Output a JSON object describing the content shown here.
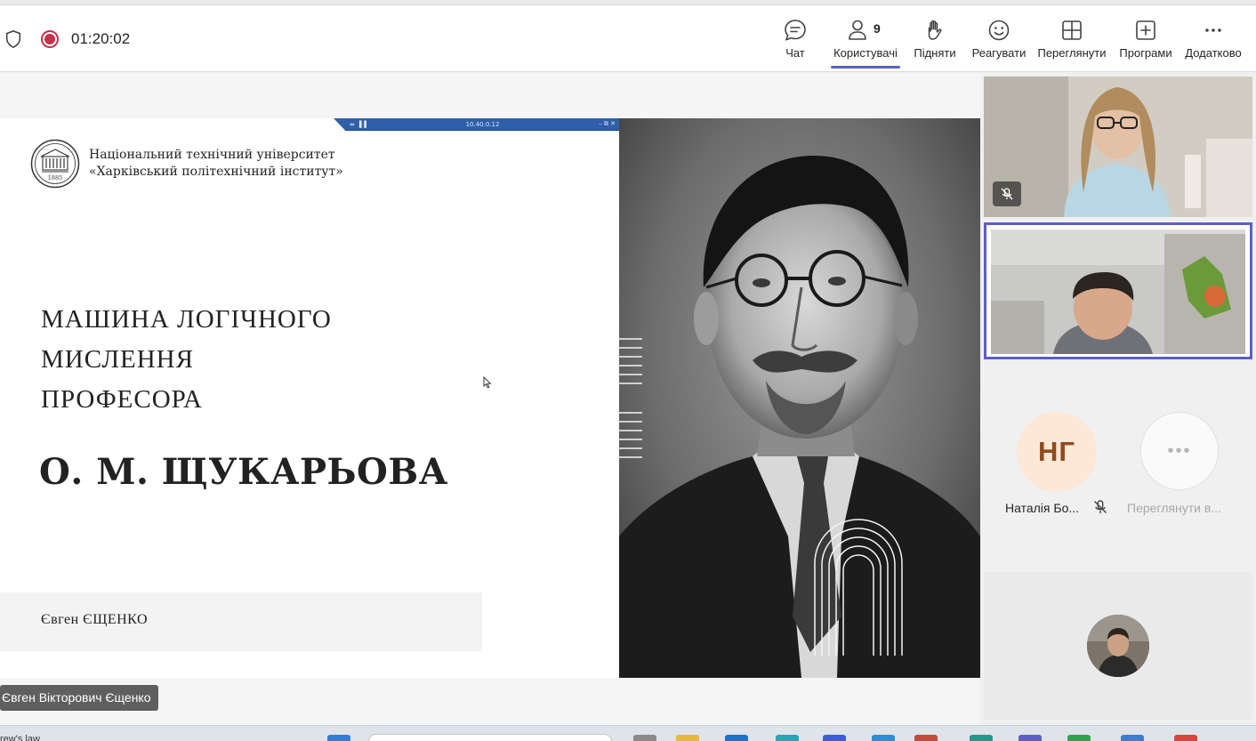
{
  "toolbar": {
    "timer": "01:20:02",
    "buttons": {
      "chat": "Чат",
      "people": "Користувачі",
      "people_count": "9",
      "raise": "Підняти",
      "react": "Реагувати",
      "view": "Переглянути",
      "apps": "Програми",
      "more": "Додатково"
    },
    "active_tab": "Користувачі",
    "accent_color": "#5b5fc7",
    "recording_color": "#c4314b"
  },
  "slide": {
    "remote_bar_ip": "10.40.0.12",
    "university_line1": "Національний технічний університет",
    "university_line2": "«Харківський політехнічний інститут»",
    "logo_year": "1885",
    "title_line1": "МАШИНА ЛОГІЧНОГО",
    "title_line2": "МИСЛЕННЯ",
    "title_line3": "ПРОФЕСОРА",
    "title_name": "О. М. ЩУКАРЬОВА",
    "author": "Євген ЄЩЕНКО"
  },
  "presenter_tag": "Євген Вікторович Єщенко",
  "participants": {
    "ng_initials": "НГ",
    "ng_name": "Наталія Бо...",
    "view_all": "Переглянути в...",
    "ng_avatar_bg": "#fde7d6",
    "ng_avatar_fg": "#8f4a1c"
  },
  "taskbar": {
    "left_text": "rew's law"
  }
}
